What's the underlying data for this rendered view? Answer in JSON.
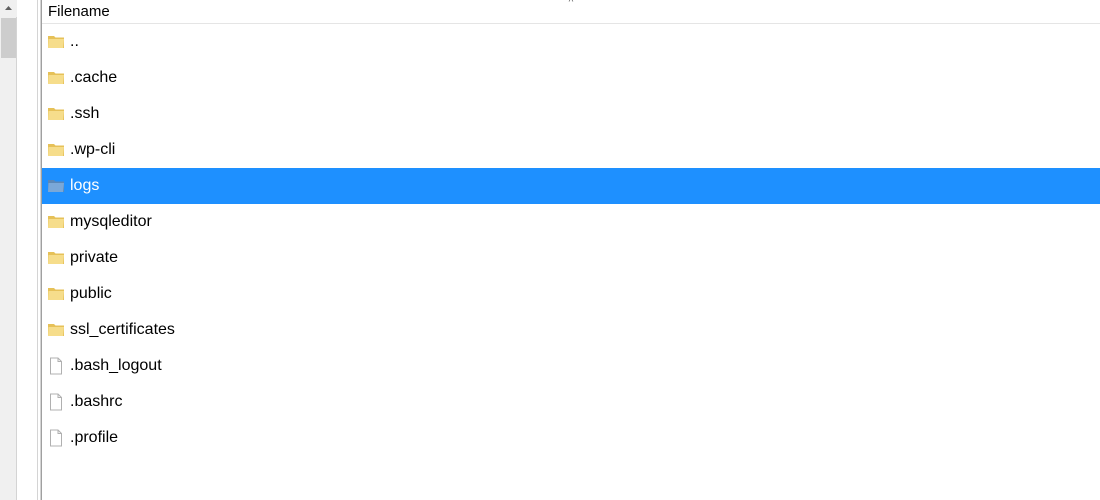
{
  "header": {
    "filename_label": "Filename",
    "sort_indicator": "^"
  },
  "items": [
    {
      "name": "..",
      "type": "folder",
      "selected": false
    },
    {
      "name": ".cache",
      "type": "folder",
      "selected": false
    },
    {
      "name": ".ssh",
      "type": "folder",
      "selected": false
    },
    {
      "name": ".wp-cli",
      "type": "folder",
      "selected": false
    },
    {
      "name": "logs",
      "type": "folder",
      "selected": true
    },
    {
      "name": "mysqleditor",
      "type": "folder",
      "selected": false
    },
    {
      "name": "private",
      "type": "folder",
      "selected": false
    },
    {
      "name": "public",
      "type": "folder",
      "selected": false
    },
    {
      "name": "ssl_certificates",
      "type": "folder",
      "selected": false
    },
    {
      "name": ".bash_logout",
      "type": "file",
      "selected": false
    },
    {
      "name": ".bashrc",
      "type": "file",
      "selected": false
    },
    {
      "name": ".profile",
      "type": "file",
      "selected": false
    }
  ]
}
